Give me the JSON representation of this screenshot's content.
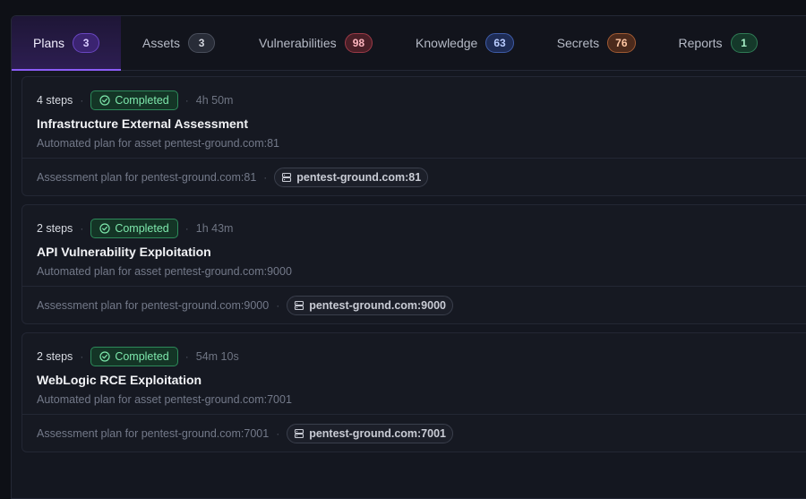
{
  "tabs": [
    {
      "label": "Plans",
      "count": "3"
    },
    {
      "label": "Assets",
      "count": "3"
    },
    {
      "label": "Vulnerabilities",
      "count": "98"
    },
    {
      "label": "Knowledge",
      "count": "63"
    },
    {
      "label": "Secrets",
      "count": "76"
    },
    {
      "label": "Reports",
      "count": "1"
    }
  ],
  "plans": [
    {
      "steps": "4 steps",
      "status": "Completed",
      "duration": "4h 50m",
      "title": "Infrastructure External Assessment",
      "description": "Automated plan for asset pentest-ground.com:81",
      "footer": "Assessment plan for pentest-ground.com:81",
      "asset": "pentest-ground.com:81"
    },
    {
      "steps": "2 steps",
      "status": "Completed",
      "duration": "1h 43m",
      "title": "API Vulnerability Exploitation",
      "description": "Automated plan for asset pentest-ground.com:9000",
      "footer": "Assessment plan for pentest-ground.com:9000",
      "asset": "pentest-ground.com:9000"
    },
    {
      "steps": "2 steps",
      "status": "Completed",
      "duration": "54m 10s",
      "title": "WebLogic RCE Exploitation",
      "description": "Automated plan for asset pentest-ground.com:7001",
      "footer": "Assessment plan for pentest-ground.com:7001",
      "asset": "pentest-ground.com:7001"
    }
  ],
  "icons": {
    "status": "check-circle-icon",
    "asset": "server-icon"
  },
  "colors": {
    "accent": "#8b5cf6",
    "completed": "#7ee8ac"
  }
}
